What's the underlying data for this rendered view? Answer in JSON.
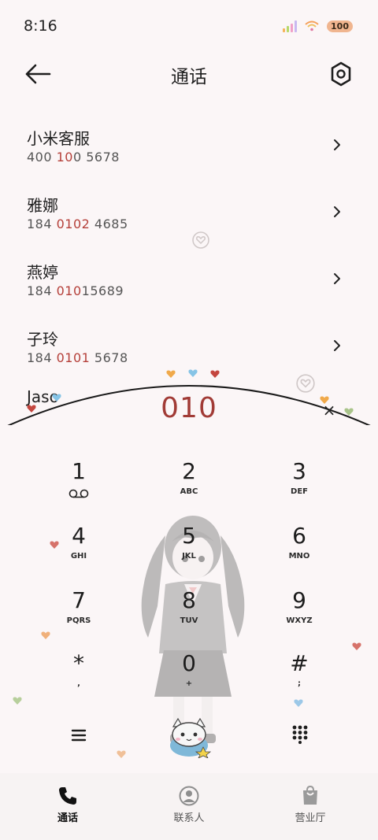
{
  "status_bar": {
    "time": "8:16",
    "battery": "100"
  },
  "header": {
    "title": "通话"
  },
  "contacts": [
    {
      "name": "小米客服",
      "number_parts": [
        "400 ",
        "10",
        "0 5678"
      ]
    },
    {
      "name": "雅娜",
      "number_parts": [
        "184 ",
        "0102",
        " 4685"
      ]
    },
    {
      "name": "燕婷",
      "number_parts": [
        "184 ",
        "010",
        "15689"
      ]
    },
    {
      "name": "子玲",
      "number_parts": [
        "184 ",
        "0101",
        " 5678"
      ]
    }
  ],
  "partial_contact": {
    "name": "Jaso"
  },
  "dial": {
    "input": "010",
    "clear_symbol": "×"
  },
  "keypad": [
    {
      "num": "1",
      "letters": ""
    },
    {
      "num": "2",
      "letters": "ABC"
    },
    {
      "num": "3",
      "letters": "DEF"
    },
    {
      "num": "4",
      "letters": "GHI"
    },
    {
      "num": "5",
      "letters": "JKL"
    },
    {
      "num": "6",
      "letters": "MNO"
    },
    {
      "num": "7",
      "letters": "PQRS"
    },
    {
      "num": "8",
      "letters": "TUV"
    },
    {
      "num": "9",
      "letters": "WXYZ"
    },
    {
      "num": "*",
      "letters": ","
    },
    {
      "num": "0",
      "letters": "+"
    },
    {
      "num": "#",
      "letters": ";"
    }
  ],
  "bottom_nav": [
    {
      "label": "通话",
      "icon": "phone-icon"
    },
    {
      "label": "联系人",
      "icon": "person-icon"
    },
    {
      "label": "营业厅",
      "icon": "shopping-bag-icon"
    }
  ],
  "colors": {
    "accent": "#a13b36",
    "background": "#fbf6f7"
  }
}
